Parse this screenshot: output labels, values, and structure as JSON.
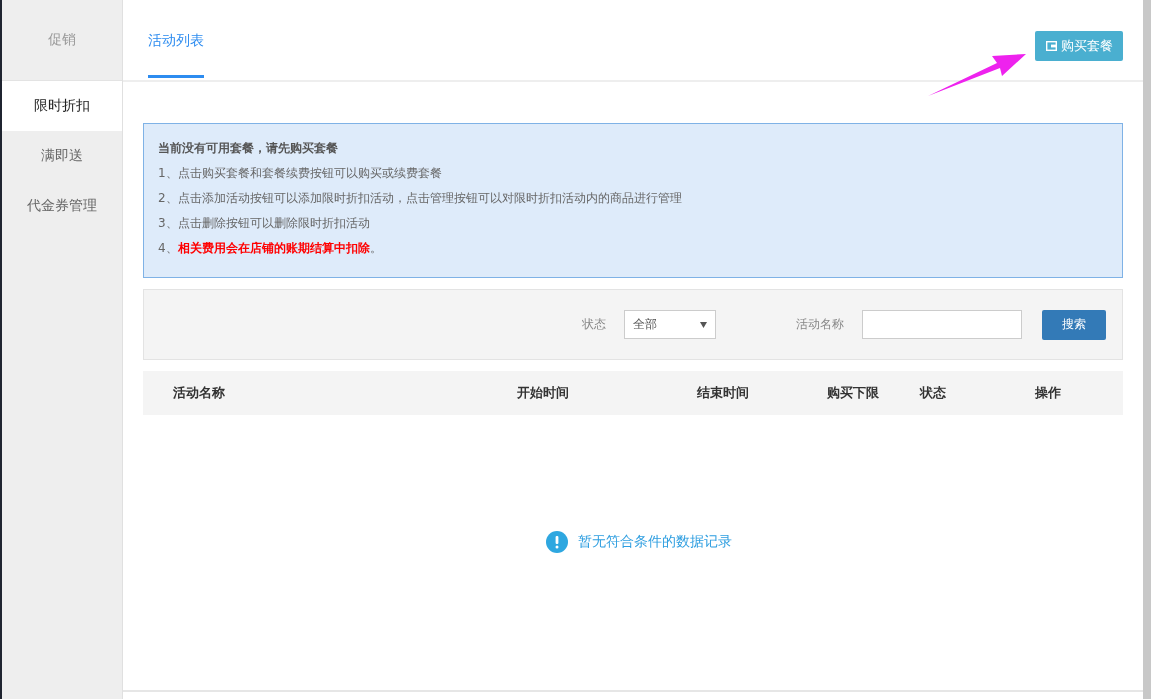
{
  "sidebar": {
    "title": "促销",
    "items": [
      {
        "label": "限时折扣",
        "selected": true
      },
      {
        "label": "满即送",
        "selected": false
      },
      {
        "label": "代金券管理",
        "selected": false
      }
    ]
  },
  "tabs": [
    {
      "label": "活动列表",
      "selected": true
    }
  ],
  "buy_button": "购买套餐",
  "notice": {
    "heading": "当前没有可用套餐，请先购买套餐",
    "lines": [
      {
        "kind": "plain",
        "prefix": "1、",
        "text": "点击购买套餐和套餐续费按钮可以购买或续费套餐"
      },
      {
        "kind": "plain",
        "prefix": "2、",
        "text": "点击添加活动按钮可以添加限时折扣活动，点击管理按钮可以对限时折扣活动内的商品进行管理"
      },
      {
        "kind": "plain",
        "prefix": "3、",
        "text": "点击删除按钮可以删除限时折扣活动"
      },
      {
        "kind": "warning",
        "prefix": "4、",
        "text": "相关费用会在店铺的账期结算中扣除",
        "suffix": "。"
      }
    ]
  },
  "filter": {
    "status_label": "状态",
    "status_value": "全部",
    "name_label": "活动名称",
    "search_button": "搜索"
  },
  "table": {
    "columns": [
      "活动名称",
      "开始时间",
      "结束时间",
      "购买下限",
      "状态",
      "操作"
    ],
    "empty_message": "暂无符合条件的数据记录"
  }
}
